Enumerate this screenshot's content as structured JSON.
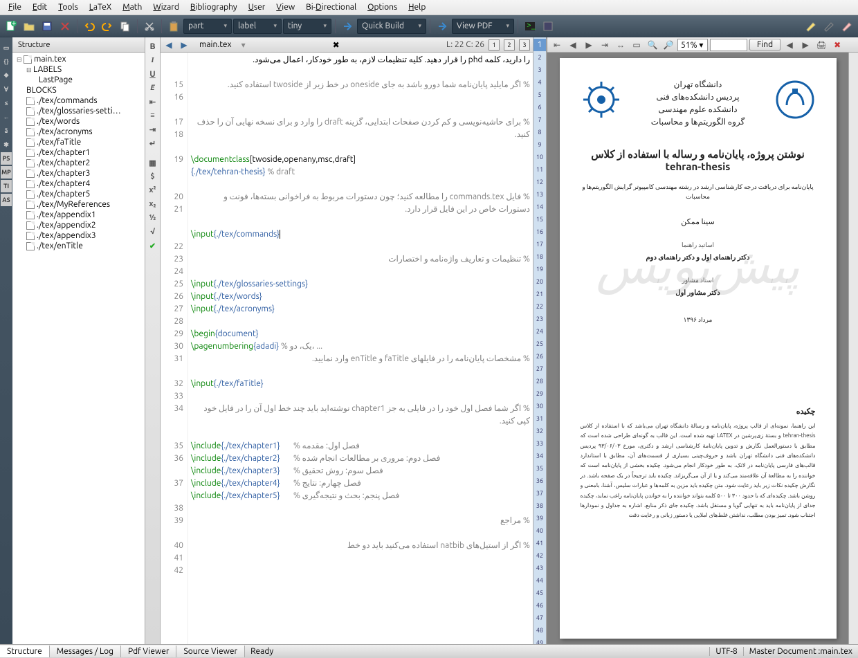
{
  "menubar": [
    "File",
    "Edit",
    "Tools",
    "LaTeX",
    "Math",
    "Wizard",
    "Bibliography",
    "User",
    "View",
    "Bi-Directional",
    "Options",
    "Help"
  ],
  "toolbar": {
    "combos": {
      "part": "part",
      "label": "label",
      "tiny": "tiny",
      "quickbuild": "Quick Build",
      "viewpdf": "View PDF"
    }
  },
  "structure": {
    "title": "Structure",
    "root": "main.tex",
    "labels": "LABELS",
    "lastpage": "LastPage",
    "blocks": "BLOCKS",
    "items": [
      "./tex/commands",
      "./tex/glossaries-setti…",
      "./tex/words",
      "./tex/acronyms",
      "./tex/faTitle",
      "./tex/chapter1",
      "./tex/chapter2",
      "./tex/chapter3",
      "./tex/chapter4",
      "./tex/chapter5",
      "./tex/MyReferences",
      "./tex/appendix1",
      "./tex/appendix2",
      "./tex/appendix3",
      "./tex/enTitle"
    ]
  },
  "editor": {
    "tab": "main.tex",
    "cursor": "L: 22 C: 26",
    "buttons": [
      "1",
      "2",
      "3"
    ]
  },
  "pdf": {
    "zoom": "51%",
    "find": "Find",
    "title": "نوشتن پروژه، پایان‌نامه و رساله با استفاده از کلاس tehran-thesis",
    "uni1": "دانشگاه تهران",
    "uni2": "پردیس دانشکده‌های فنی",
    "uni3": "دانشکده علوم مهندسی",
    "uni4": "گروه الگوریتم‌ها و محاسبات",
    "sub": "پایان‌نامه برای دریافت درجه کارشناسی ارشد در رشته مهندسی کامپیوتر گرایش الگوریتم‌ها و محاسبات",
    "author": "سینا ممکن",
    "role1": "اساتید راهنما",
    "sup": "دکتر راهنمای اول و دکتر راهنمای دوم",
    "role2": "استاد مشاور",
    "adv": "دکتر مشاور اول",
    "date": "مرداد ۱۳۹۶",
    "abs_title": "چکیده",
    "abs_body": "این راهنما، نمونه‌ای از قالب پروژه، پایان‌نامه و رسالهٔ دانشگاه تهران می‌باشد که با استفاده از کلاس tehran-thesis و بستهٔ زی‌پرشین در LATEX تهیه شده است. این قالب به گونه‌ای طراحی شده است که مطابق با دستورالعمل نگارش و تدوین پایان‌نامهٔ کارشناسی ارشد و دکتری، مورخ ۹۳/۰۶/۰۳ پردیس دانشکده‌های فنی دانشگاه تهران باشد و حروف‌چینی بسیاری از قسمت‌های آن، مطابق با استاندارد قالب‌های فارسی پایان‌نامه در لاتک، به طور خودکار انجام می‌شود. چکیده بخشی از پایان‌نامه است که خواننده را به مطالعهٔ آن علاقه‌مند می‌کند و یا از آن می‌گریزاند. چکیده باید ترجیحاً در یک صفحه باشد. در نگارش چکیده نکات زیر باید رعایت شود. متن چکیده باید مزین به کلمه‌ها و عبارات سلیس، آشنا، بامعنی و روشن باشد. چکیده‌ای که با حدود ۳۰۰ تا ۵۰۰ کلمه بتواند خواننده را به خواندن پایان‌نامه راغب نماید، چکیده جدای از پایان‌نامه باید به تنهایی گویا و مستقل باشد. چکیده جای ذکر منابع، اشاره به جداول و نمودارها اجتناب شود. تمیز بودن مطلب، نداشتن غلط‌های املایی یا دستور زبانی و رعایت دقت"
  },
  "status": {
    "tabs": [
      "Structure",
      "Messages / Log",
      "Pdf Viewer",
      "Source Viewer"
    ],
    "ready": "Ready",
    "encoding": "UTF-8",
    "master": "Master Document :main.tex"
  }
}
